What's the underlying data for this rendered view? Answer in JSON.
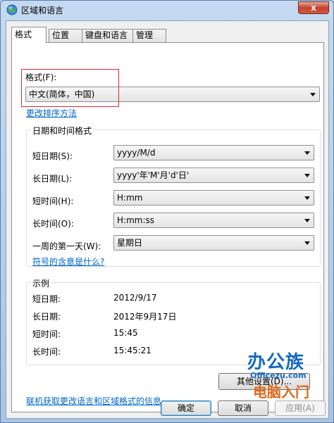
{
  "window": {
    "title": "区域和语言",
    "close_label": "x"
  },
  "tabs": [
    "格式",
    "位置",
    "键盘和语言",
    "管理"
  ],
  "format": {
    "label": "格式(F):",
    "value": "中文(简体，中国)",
    "sort_link": "更改排序方法"
  },
  "datetime": {
    "group_title": "日期和时间格式",
    "rows": [
      {
        "label": "短日期(S):",
        "value": "yyyy/M/d"
      },
      {
        "label": "长日期(L):",
        "value": "yyyy'年'M'月'd'日'"
      },
      {
        "label": "短时间(H):",
        "value": "H:mm"
      },
      {
        "label": "长时间(O):",
        "value": "H:mm:ss"
      },
      {
        "label": "一周的第一天(W):",
        "value": "星期日"
      }
    ],
    "meaning_link": "符号的含意是什么?"
  },
  "example": {
    "group_title": "示例",
    "rows": [
      {
        "label": "短日期:",
        "value": "2012/9/17"
      },
      {
        "label": "长日期:",
        "value": "2012年9月17日"
      },
      {
        "label": "短时间:",
        "value": "15:45"
      },
      {
        "label": "长时间:",
        "value": "15:45:21"
      }
    ]
  },
  "other_settings_label": "其他设置(D)...",
  "online_link": "联机获取更改语言和区域格式的信息",
  "buttons": {
    "ok": "确定",
    "cancel": "取消",
    "apply": "应用(A)"
  },
  "watermark": {
    "brand": "办公族",
    "url": "Officezu.com",
    "tagline": "电脑入门"
  }
}
